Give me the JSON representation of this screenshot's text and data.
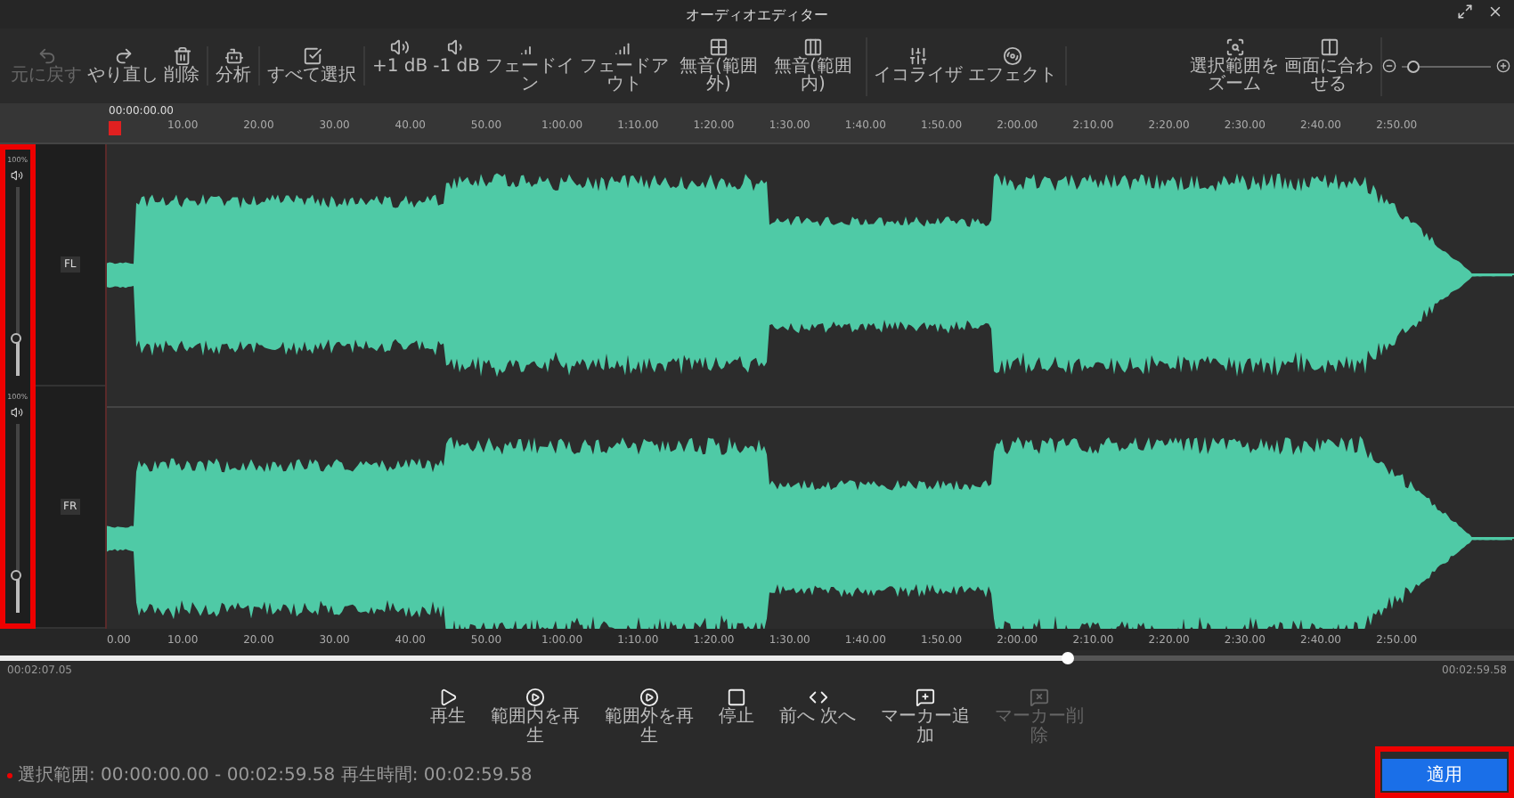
{
  "window": {
    "title": "オーディオエディター"
  },
  "toolbar": {
    "groups": [
      [
        {
          "label": "元に戻す",
          "disabled": true
        },
        {
          "label": "やり直し",
          "disabled": false
        },
        {
          "label": "削除",
          "disabled": false
        }
      ],
      [
        {
          "label": "分析",
          "disabled": false
        }
      ],
      [
        {
          "label": "すべて選択",
          "disabled": false
        }
      ],
      [
        {
          "label": "+1 dB",
          "disabled": false
        },
        {
          "label": "-1 dB",
          "disabled": false
        },
        {
          "label": "フェードイン",
          "disabled": false
        },
        {
          "label": "フェードアウト",
          "disabled": false
        },
        {
          "label": "無音(範囲外)",
          "disabled": false
        },
        {
          "label": "無音(範囲内)",
          "disabled": false
        }
      ],
      [
        {
          "label": "イコライザ",
          "disabled": false
        },
        {
          "label": "エフェクト",
          "disabled": false
        }
      ]
    ],
    "right": [
      {
        "label": "選択範囲をズーム",
        "disabled": false
      },
      {
        "label": "画面に合わせる",
        "disabled": false
      }
    ],
    "zoom": {
      "level": 0.05
    }
  },
  "ruler": {
    "start": "00:00:00.00",
    "labels": [
      "10.00",
      "20.00",
      "30.00",
      "40.00",
      "50.00",
      "1:00.00",
      "1:10.00",
      "1:20.00",
      "1:30.00",
      "1:40.00",
      "1:50.00",
      "2:00.00",
      "2:10.00",
      "2:20.00",
      "2:30.00",
      "2:40.00",
      "2:50.00"
    ]
  },
  "tracks": [
    {
      "channel": "FL",
      "volume": "100%",
      "level": 0.2
    },
    {
      "channel": "FR",
      "volume": "100%",
      "level": 0.2
    }
  ],
  "bottom_ruler": {
    "labels": [
      "0.00",
      "10.00",
      "20.00",
      "30.00",
      "40.00",
      "50.00",
      "1:00.00",
      "1:10.00",
      "1:20.00",
      "1:30.00",
      "1:40.00",
      "1:50.00",
      "2:00.00",
      "2:10.00",
      "2:20.00",
      "2:30.00",
      "2:40.00",
      "2:50.00"
    ]
  },
  "playback": {
    "level": 0.705,
    "current": "00:02:07.05",
    "total": "00:02:59.58"
  },
  "transport": [
    {
      "label": "再生",
      "disabled": false
    },
    {
      "label": "範囲内を再生",
      "disabled": false
    },
    {
      "label": "範囲外を再生",
      "disabled": false
    },
    {
      "label": "停止",
      "disabled": false
    },
    {
      "label": "前へ 次へ",
      "disabled": false
    },
    {
      "label": "マーカー追加",
      "disabled": false
    },
    {
      "label": "マーカー削除",
      "disabled": true
    }
  ],
  "status": "選択範囲: 00:00:00.00 - 00:02:59.58 再生時間: 00:02:59.58",
  "apply_button": "適用"
}
